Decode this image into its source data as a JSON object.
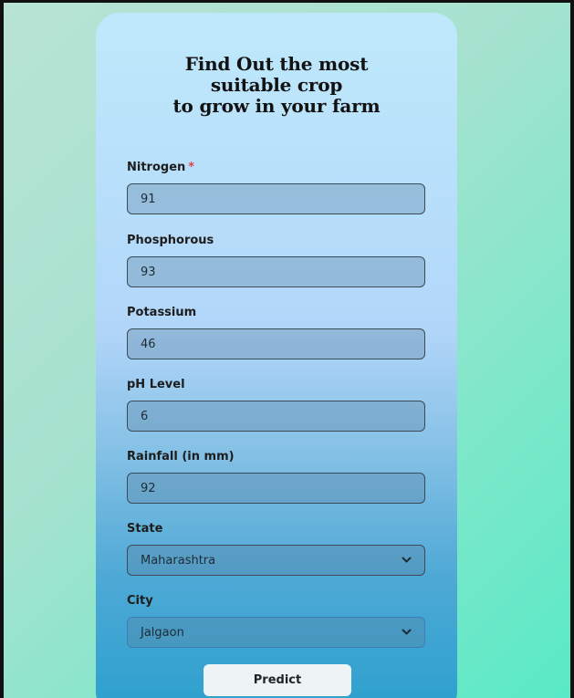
{
  "title": {
    "line1": "Find Out the most",
    "line2": "suitable crop",
    "line3": "to grow in your farm"
  },
  "fields": {
    "nitrogen": {
      "label": "Nitrogen",
      "required_mark": "*",
      "value": "91"
    },
    "phosphorous": {
      "label": "Phosphorous",
      "value": "93"
    },
    "potassium": {
      "label": "Potassium",
      "value": "46"
    },
    "ph": {
      "label": "pH Level",
      "value": "6"
    },
    "rainfall": {
      "label": "Rainfall (in mm)",
      "value": "92"
    },
    "state": {
      "label": "State",
      "value": "Maharashtra",
      "icon": "chevron-down-icon"
    },
    "city": {
      "label": "City",
      "value": "Jalgaon",
      "icon": "chevron-down-icon"
    }
  },
  "predict_button": {
    "label": "Predict"
  },
  "colors": {
    "required": "#e04444",
    "card_top": "#bfe9fb",
    "card_bottom": "#2ba0ce",
    "page_bg": "#79e8c9"
  }
}
